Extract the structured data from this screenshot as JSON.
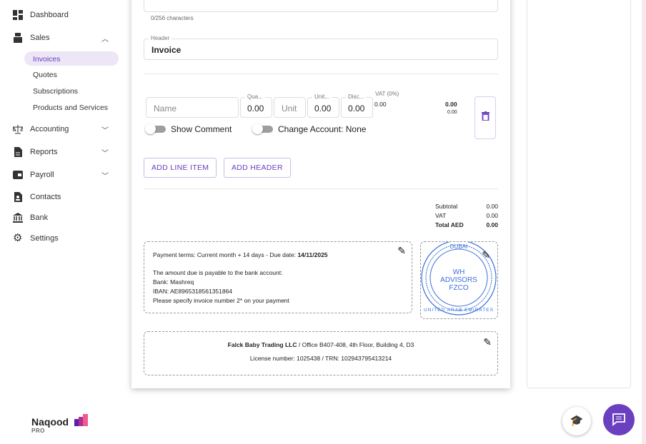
{
  "sidebar": {
    "items": [
      {
        "label": "Dashboard",
        "icon": "dashboard-icon"
      },
      {
        "label": "Sales",
        "icon": "cash-register-icon"
      },
      {
        "label": "Accounting",
        "icon": "scale-icon"
      },
      {
        "label": "Reports",
        "icon": "report-icon"
      },
      {
        "label": "Payroll",
        "icon": "wallet-icon"
      },
      {
        "label": "Contacts",
        "icon": "contact-icon"
      },
      {
        "label": "Bank",
        "icon": "bank-icon"
      },
      {
        "label": "Settings",
        "icon": "gear-icon"
      }
    ],
    "sales_sub": [
      "Invoices",
      "Quotes",
      "Subscriptions",
      "Products and Services"
    ],
    "logo": {
      "name": "Naqood",
      "tier": "PRO"
    }
  },
  "form": {
    "char_count": "0/256 characters",
    "header_label": "Header",
    "header_value": "Invoice",
    "line": {
      "name_placeholder": "Name",
      "qty_label": "Qua...",
      "qty": "0.00",
      "unit_placeholder": "Unit",
      "unit_price_label": "Unit...",
      "unit_price": "0.00",
      "disc_label": "Disc...",
      "disc": "0.00",
      "vat_label": "VAT (0%)",
      "vat": "0.00",
      "total": "0.00",
      "total_sub": "0.00",
      "show_comment": "Show Comment",
      "change_account": "Change Account: None"
    },
    "add_line_item": "ADD LINE ITEM",
    "add_header": "ADD HEADER",
    "totals": [
      {
        "label": "Subtotal",
        "value": "0.00"
      },
      {
        "label": "VAT",
        "value": "0.00"
      },
      {
        "label": "Total AED",
        "value": "0.00"
      }
    ],
    "payment": {
      "terms": "Payment terms: Current month + 14 days - Due date: ",
      "due_date": "14/11/2025",
      "l1": "The amount due is payable to the bank account:",
      "l2": "Bank: Mashreq",
      "l3": "IBAN: AE8965318561351864",
      "l4": "Please specify invoice number 2* on your payment"
    },
    "stamp": {
      "top": "DUBAI",
      "center1": "WH",
      "center2": "ADVISORS",
      "center3": "FZCO",
      "bottom": "UNITED ARAB EMIRATES"
    },
    "footer": {
      "company": "Falck Baby Trading LLC",
      "address": "/  Office B407-408, 4th Floor, Building 4, D3",
      "license": "License number: 1025438 / TRN: 102943795413214"
    }
  },
  "colors": {
    "accent": "#6a3fc0",
    "stamp": "#3a6fd8"
  }
}
